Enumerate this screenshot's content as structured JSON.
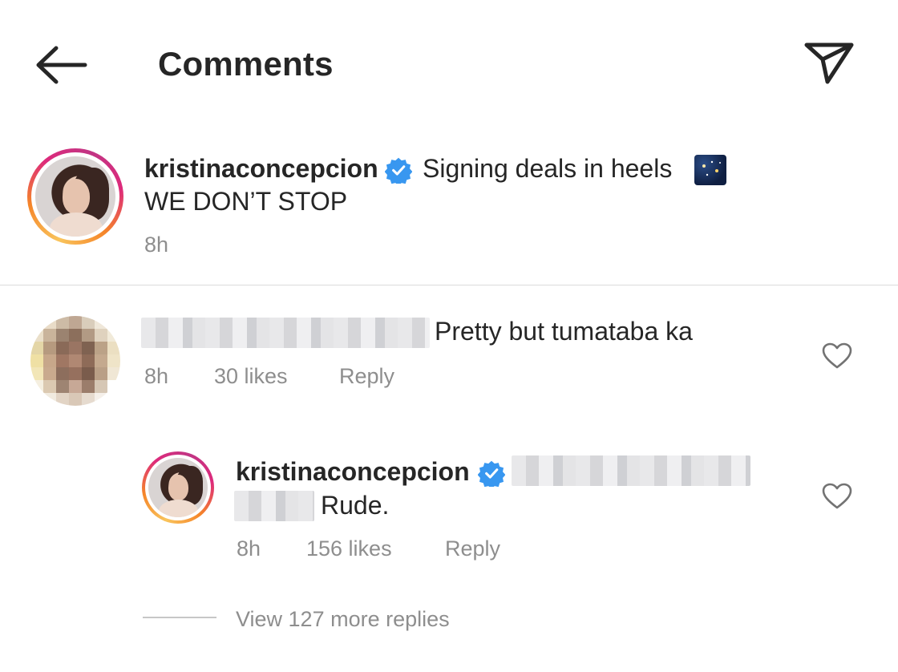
{
  "header": {
    "title": "Comments",
    "back_icon": "arrow-left-icon",
    "share_icon": "paper-plane-icon"
  },
  "caption": {
    "username": "kristinaconcepcion",
    "verified_icon": "verified-badge-icon",
    "text_line1": "Signing deals in heels",
    "emoji": "night-sky-emoji",
    "text_line2": "WE DON’T STOP",
    "time": "8h"
  },
  "comment": {
    "username_redacted": true,
    "text": "Pretty but tumataba ka",
    "time": "8h",
    "likes": "30 likes",
    "reply_label": "Reply",
    "like_icon": "heart-outline-icon"
  },
  "reply": {
    "username": "kristinaconcepcion",
    "verified_icon": "verified-badge-icon",
    "text": "Rude.",
    "time": "8h",
    "likes": "156 likes",
    "reply_label": "Reply",
    "like_icon": "heart-outline-icon"
  },
  "view_more": "View 127 more replies",
  "colors": {
    "text": "#262626",
    "muted": "#8e8e8e",
    "verified": "#3897f0",
    "divider": "#dbdbdb"
  }
}
